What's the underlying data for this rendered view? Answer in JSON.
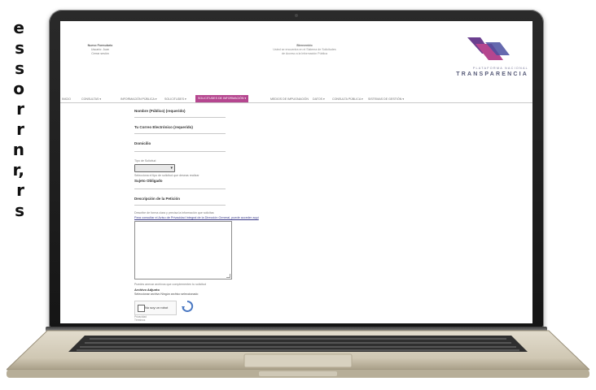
{
  "side_text": {
    "lines": [
      "e",
      "s",
      "s",
      "o",
      "r",
      "r",
      "n",
      "r,",
      "r",
      "s"
    ]
  },
  "site": {
    "header_left": {
      "line1": "Nuevo Formulario",
      "line2": "Usuario: Juan",
      "line3": "Cerrar sesión"
    },
    "header_center": {
      "line1": "Bienvenido",
      "line2": "Usted se encuentra en el Sistema de Solicitudes",
      "line3": "de Acceso a la Información Pública"
    },
    "logo": {
      "line1": "PLATAFORMA NACIONAL",
      "line2": "TRANSPARENCIA"
    }
  },
  "nav": {
    "items": [
      {
        "label": "INICIO"
      },
      {
        "label": "CONSULTAS ▾"
      },
      {
        "label": "INFORMACIÓN PÚBLICA ▾"
      },
      {
        "label": "SOLICITUDES ▾"
      },
      {
        "label": "SOLICITUDES DE INFORMACIÓN ▾",
        "active": true
      },
      {
        "label": "MEDIOS DE IMPUGNACIÓN"
      },
      {
        "label": "DATOS ▾"
      },
      {
        "label": "CONSULTA PÚBLICA ▾"
      },
      {
        "label": "SISTEMAS DE GESTIÓN ▾"
      }
    ]
  },
  "form": {
    "field1_label": "Nombre (Público) (requerido)",
    "field2_label": "Tu Correo Electrónico (requerido)",
    "field3_label": "Domicilio",
    "select_label": "Tipo de Solicitud",
    "select_value": "Solicitud",
    "select_help": "Selecciona el tipo de solicitud que deseas realizar",
    "sujeto_label": "Sujeto Obligado",
    "field5_label": "Descripción de la Petición",
    "textarea_help": "Describe de forma clara y precisa la información que solicitas",
    "textarea_link": "Para consultar el Aviso de Privacidad Integral de la Dirección General, puede acceder aquí",
    "file_help": "Puedes anexar archivos que complementen tu solicitud",
    "file_label": "Archivo Adjunto",
    "file_button": "Seleccionar archivo",
    "file_none": "Ningún archivo seleccionado",
    "captcha_label": "No soy un robot",
    "captcha_foot1": "Privacidad",
    "captcha_foot2": "Términos"
  }
}
